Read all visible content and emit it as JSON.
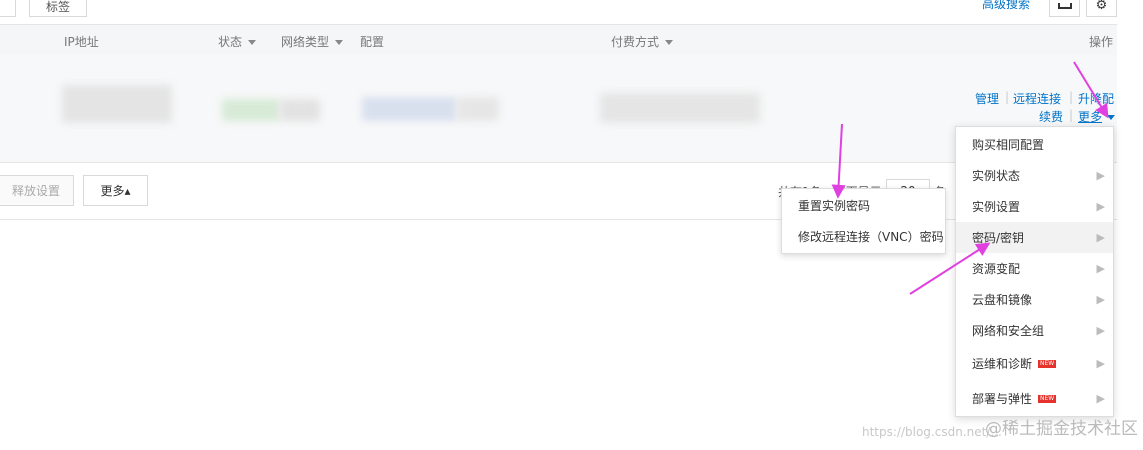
{
  "toolbar": {
    "tag_button": "标签",
    "advanced_search": "高级搜索"
  },
  "table": {
    "headers": {
      "ip": "IP地址",
      "status": "状态",
      "network_type": "网络类型",
      "config": "配置",
      "payment": "付费方式",
      "actions": "操作"
    },
    "row_actions": {
      "manage": "管理",
      "remote_connect": "远程连接",
      "upgrade": "升降配",
      "renew": "续费",
      "more": "更多"
    }
  },
  "footer": {
    "release_settings": "释放设置",
    "more": "更多▴",
    "pagination_text": "共有1条，每页显示",
    "per_page": "20",
    "unit": "条"
  },
  "more_menu": {
    "items": [
      {
        "label": "购买相同配置",
        "has_submenu": false,
        "is_new": false
      },
      {
        "label": "实例状态",
        "has_submenu": true,
        "is_new": false
      },
      {
        "label": "实例设置",
        "has_submenu": true,
        "is_new": false
      },
      {
        "label": "密码/密钥",
        "has_submenu": true,
        "is_new": false
      },
      {
        "label": "资源变配",
        "has_submenu": true,
        "is_new": false
      },
      {
        "label": "云盘和镜像",
        "has_submenu": true,
        "is_new": false
      },
      {
        "label": "网络和安全组",
        "has_submenu": true,
        "is_new": false
      },
      {
        "label": "运维和诊断",
        "has_submenu": true,
        "is_new": true
      },
      {
        "label": "部署与弹性",
        "has_submenu": true,
        "is_new": true
      }
    ],
    "new_badge": "NEW"
  },
  "password_submenu": {
    "items": [
      "重置实例密码",
      "修改远程连接（VNC）密码"
    ]
  },
  "watermark": {
    "url": "https://blog.csdn.net/...",
    "brand": "@稀土掘金技术社区"
  },
  "colors": {
    "link": "#0073c8",
    "annotation_arrow": "#e040e0",
    "new_badge": "#e5322d"
  }
}
